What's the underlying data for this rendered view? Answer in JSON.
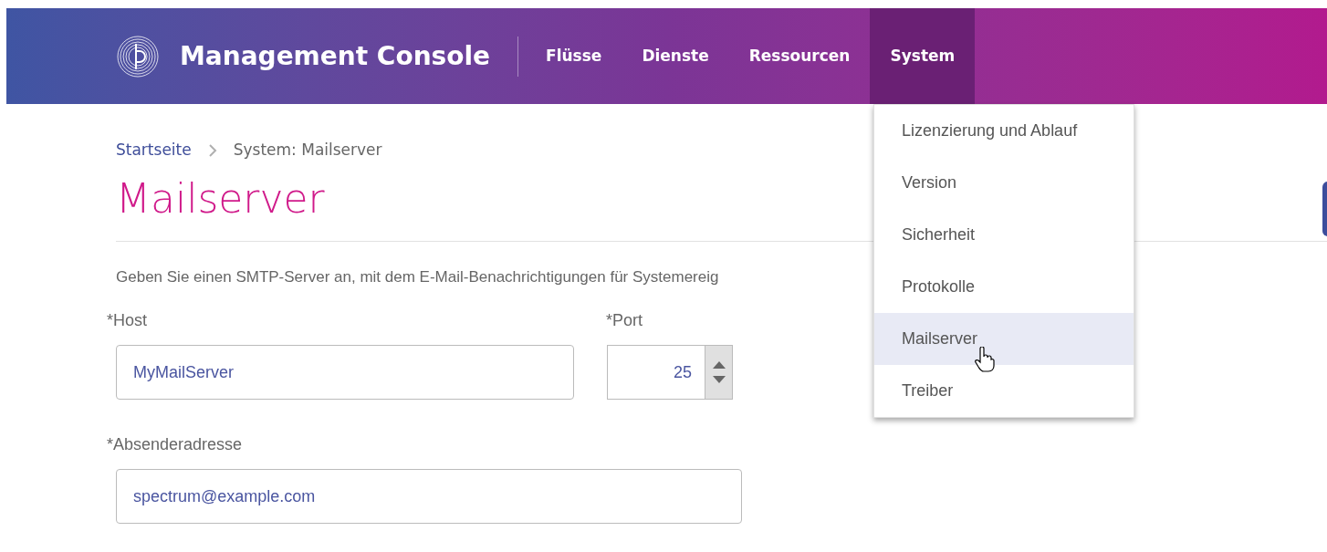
{
  "header": {
    "title": "Management Console",
    "nav": [
      {
        "label": "Flüsse",
        "selected": false
      },
      {
        "label": "Dienste",
        "selected": false
      },
      {
        "label": "Ressourcen",
        "selected": false
      },
      {
        "label": "System",
        "selected": true
      }
    ]
  },
  "menu": {
    "items": [
      {
        "label": "Lizenzierung und Ablauf",
        "selected": false
      },
      {
        "label": "Version",
        "selected": false
      },
      {
        "label": "Sicherheit",
        "selected": false
      },
      {
        "label": "Protokolle",
        "selected": false
      },
      {
        "label": "Mailserver",
        "selected": true
      },
      {
        "label": "Treiber",
        "selected": false
      }
    ]
  },
  "breadcrumb": {
    "home": "Startseite",
    "current": "System: Mailserver"
  },
  "page_title": "Mailserver",
  "description": "Geben Sie einen SMTP-Server an, mit dem E-Mail-Benachrichtigungen für Systemereig",
  "form": {
    "host": {
      "label": "*Host",
      "value": "MyMailServer"
    },
    "port": {
      "label": "*Port",
      "value": "25"
    },
    "sender": {
      "label": "*Absenderadresse",
      "value": "spectrum@example.com"
    }
  }
}
